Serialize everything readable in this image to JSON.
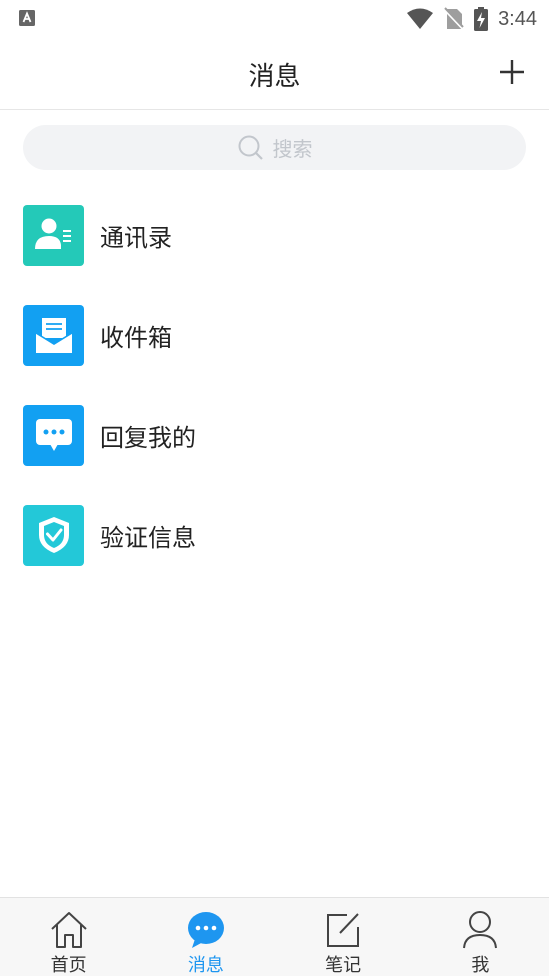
{
  "status_bar": {
    "time": "3:44"
  },
  "header": {
    "title": "消息"
  },
  "search": {
    "placeholder": "搜索"
  },
  "menu": [
    {
      "label": "通讯录",
      "icon": "contacts-icon",
      "color": "#24c9b8"
    },
    {
      "label": "收件箱",
      "icon": "inbox-icon",
      "color": "#12a0f2"
    },
    {
      "label": "回复我的",
      "icon": "reply-icon",
      "color": "#12a0f2"
    },
    {
      "label": "验证信息",
      "icon": "verify-icon",
      "color": "#23c8d8"
    }
  ],
  "bottom_nav": [
    {
      "label": "首页",
      "icon": "home-icon",
      "active": false
    },
    {
      "label": "消息",
      "icon": "message-icon",
      "active": true
    },
    {
      "label": "笔记",
      "icon": "note-icon",
      "active": false
    },
    {
      "label": "我",
      "icon": "profile-icon",
      "active": false
    }
  ],
  "colors": {
    "accent": "#1e96f0",
    "inactive": "#444444"
  }
}
